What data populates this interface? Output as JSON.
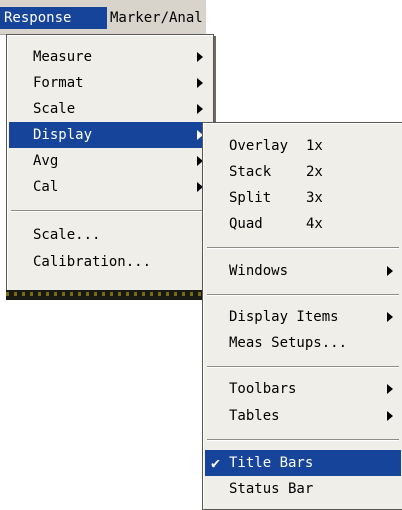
{
  "menubar": {
    "items": [
      {
        "label": "Response",
        "mnemonic_index": 0
      },
      {
        "label": "Marker/Anal",
        "mnemonic_index": 0
      }
    ]
  },
  "response_menu": {
    "items": [
      {
        "label": "Measure",
        "submenu": true
      },
      {
        "label": "Format",
        "submenu": true
      },
      {
        "label": "Scale",
        "submenu": true
      },
      {
        "label": "Display",
        "submenu": true,
        "highlighted": true
      },
      {
        "label": "Avg",
        "submenu": true
      },
      {
        "label": "Cal",
        "submenu": true
      },
      {
        "label": "Scale...",
        "submenu": false
      },
      {
        "label": "Calibration...",
        "submenu": false
      }
    ]
  },
  "display_submenu": {
    "items": [
      {
        "label": "Overlay",
        "shortcut": "1x"
      },
      {
        "label": "Stack",
        "shortcut": "2x"
      },
      {
        "label": "Split",
        "shortcut": "3x"
      },
      {
        "label": "Quad",
        "shortcut": "4x"
      },
      {
        "label": "Windows",
        "submenu": true
      },
      {
        "label": "Display Items",
        "submenu": true
      },
      {
        "label": "Meas Setups...",
        "submenu": false
      },
      {
        "label": "Toolbars",
        "submenu": true
      },
      {
        "label": "Tables",
        "submenu": true
      },
      {
        "label": "Title Bars",
        "checked": true,
        "highlighted": true
      },
      {
        "label": "Status Bar",
        "checked": false
      }
    ]
  },
  "colors": {
    "highlight": "#16449a",
    "menu_background": "#efeee9",
    "menubar_background": "#d8d4cc"
  }
}
